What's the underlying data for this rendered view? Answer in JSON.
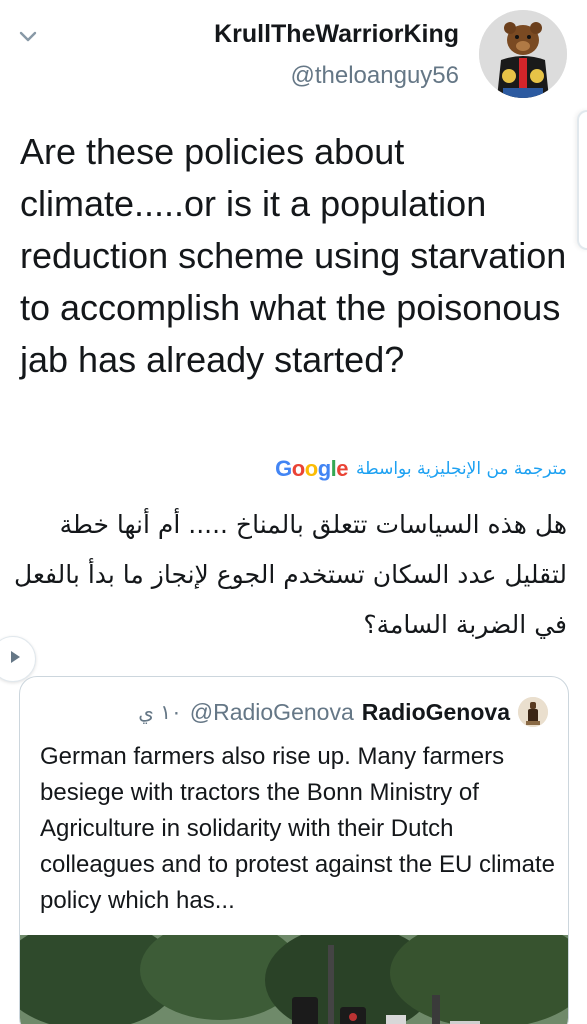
{
  "header": {
    "display_name": "KrullTheWarriorKing",
    "handle": "@theloanguy56"
  },
  "tweet": {
    "text": "Are these policies about climate.....or is it a population reduction scheme using starvation to accomplish what the poisonous jab has already started?"
  },
  "translation": {
    "label": "مترجمة من الإنجليزية بواسطة",
    "provider": "Google",
    "text": "هل هذه السياسات تتعلق بالمناخ ..... أم أنها خطة لتقليل عدد السكان تستخدم الجوع لإنجاز ما بدأ بالفعل في الضربة السامة؟"
  },
  "quoted_tweet": {
    "name": "RadioGenova",
    "handle": "@RadioGenova",
    "time": "١٠ ي",
    "text": "German farmers also rise up. Many farmers besiege with tractors the Bonn Ministry of Agriculture in solidarity with their Dutch colleagues and to protest against the EU climate policy which has..."
  },
  "icons": {
    "chevron": "chevron-down-icon",
    "side": "play-arrow-icon"
  },
  "colors": {
    "text": "#14171a",
    "secondary": "#657786",
    "link": "#1da1f2",
    "border": "#ccd6dd"
  }
}
